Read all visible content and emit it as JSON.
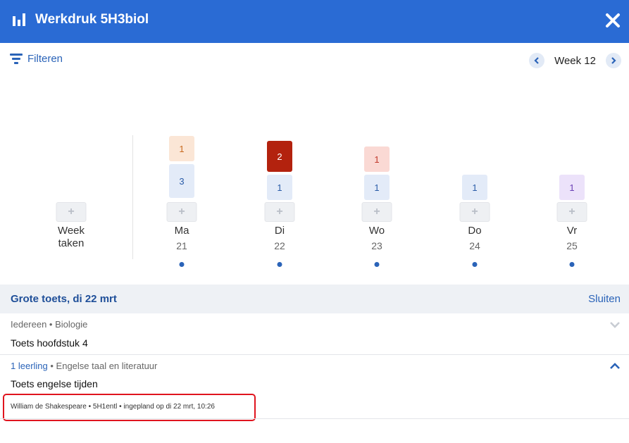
{
  "header": {
    "title": "Werkdruk 5H3biol",
    "chart_icon": "bar-chart-icon",
    "close_icon": "close-icon"
  },
  "toolbar": {
    "filter_label": "Filteren",
    "week_label": "Week 12"
  },
  "week_tasks": {
    "label_line1": "Week",
    "label_line2": "taken",
    "add": "+"
  },
  "days": [
    {
      "name": "Ma",
      "num": "21",
      "add": "+",
      "badges": [
        {
          "value": "1",
          "bg": "#fbe6d6",
          "color": "#c86a20"
        },
        {
          "value": "3",
          "bg": "#e3ebf8",
          "color": "#2a5ca8"
        }
      ]
    },
    {
      "name": "Di",
      "num": "22",
      "add": "+",
      "badges": [
        {
          "value": "2",
          "bg": "#b3220e",
          "color": "#ffffff"
        },
        {
          "value": "1",
          "bg": "#e3ebf8",
          "color": "#2a5ca8"
        }
      ]
    },
    {
      "name": "Wo",
      "num": "23",
      "add": "+",
      "badges": [
        {
          "value": "1",
          "bg": "#fad9d4",
          "color": "#c0392b"
        },
        {
          "value": "1",
          "bg": "#e3ebf8",
          "color": "#2a5ca8"
        }
      ]
    },
    {
      "name": "Do",
      "num": "24",
      "add": "+",
      "badges": [
        {
          "value": "1",
          "bg": "#e3ebf8",
          "color": "#2a5ca8"
        }
      ]
    },
    {
      "name": "Vr",
      "num": "25",
      "add": "+",
      "badges": [
        {
          "value": "1",
          "bg": "#ece2fa",
          "color": "#6a3fb5"
        }
      ]
    }
  ],
  "section": {
    "title": "Grote toets, di 22 mrt",
    "close_label": "Sluiten"
  },
  "items": [
    {
      "meta_prefix": "",
      "meta_rest": "Iedereen • Biologie",
      "name": "Toets hoofdstuk 4"
    },
    {
      "meta_prefix": "1 leerling",
      "meta_rest": " • Engelse taal en literatuur",
      "name": "Toets engelse tijden",
      "detail": "William de Shakespeare • 5H1entl • ingepland op di 22 mrt, 10:26"
    }
  ],
  "colors": {
    "accent": "#2a6bd4",
    "highlight": "#e0141e"
  }
}
